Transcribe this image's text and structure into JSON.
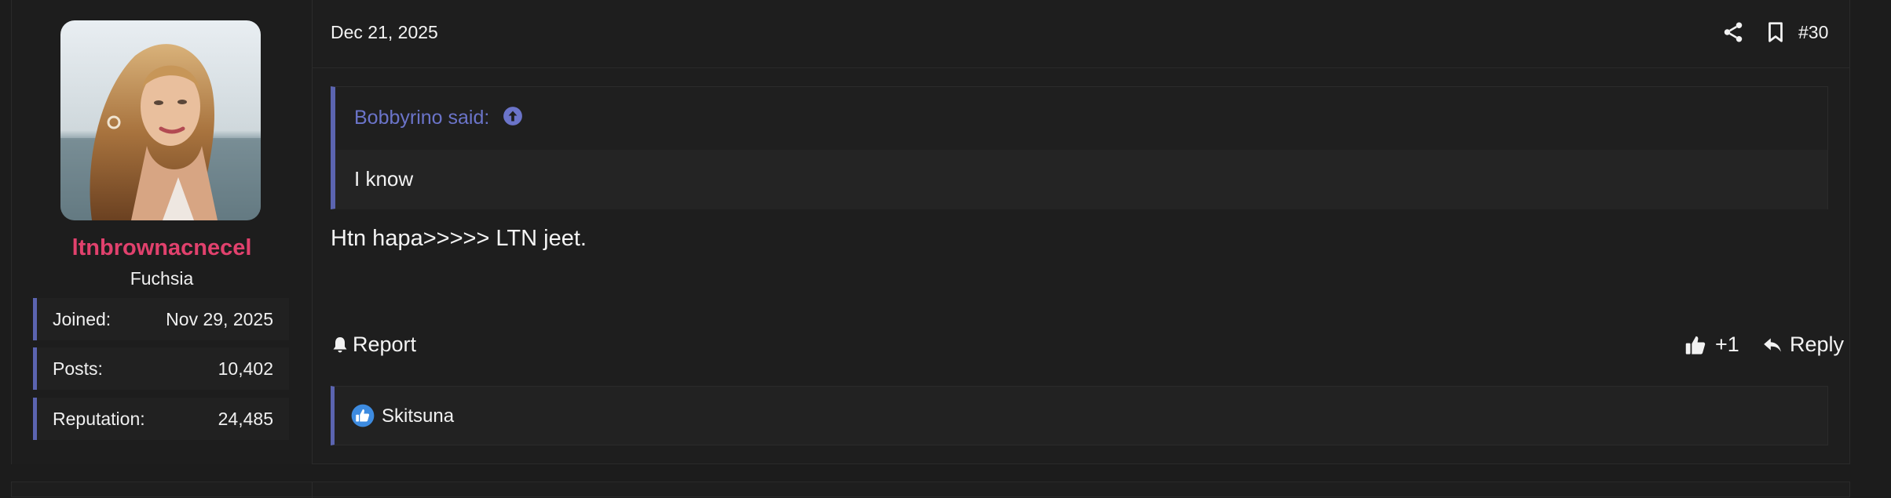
{
  "post": {
    "date": "Dec 21, 2025",
    "number": "#30",
    "author": {
      "username": "ltnbrownacnecel",
      "title": "Fuchsia",
      "stats": [
        {
          "label": "Joined:",
          "value": "Nov 29, 2025"
        },
        {
          "label": "Posts:",
          "value": "10,402"
        },
        {
          "label": "Reputation:",
          "value": "24,485"
        }
      ]
    },
    "quote": {
      "attribution": "Bobbyrino said:",
      "text": "I know"
    },
    "message": "Htn hapa>>>>> LTN jeet.",
    "actions": {
      "report": "Report",
      "like": "+1",
      "reply": "Reply"
    },
    "reactions": {
      "users": "Skitsuna"
    }
  },
  "icons": {
    "share": "share-icon",
    "bookmark": "bookmark-icon",
    "quote_jump": "arrow-up-circle-icon",
    "report": "bell-icon",
    "like": "thumbs-up-icon",
    "reply": "reply-icon",
    "reaction": "like-reaction-icon"
  },
  "colors": {
    "username": "#e1416d",
    "accent": "#5b64b0",
    "quote_link": "#6b74c9",
    "background": "#1c1c1c"
  }
}
